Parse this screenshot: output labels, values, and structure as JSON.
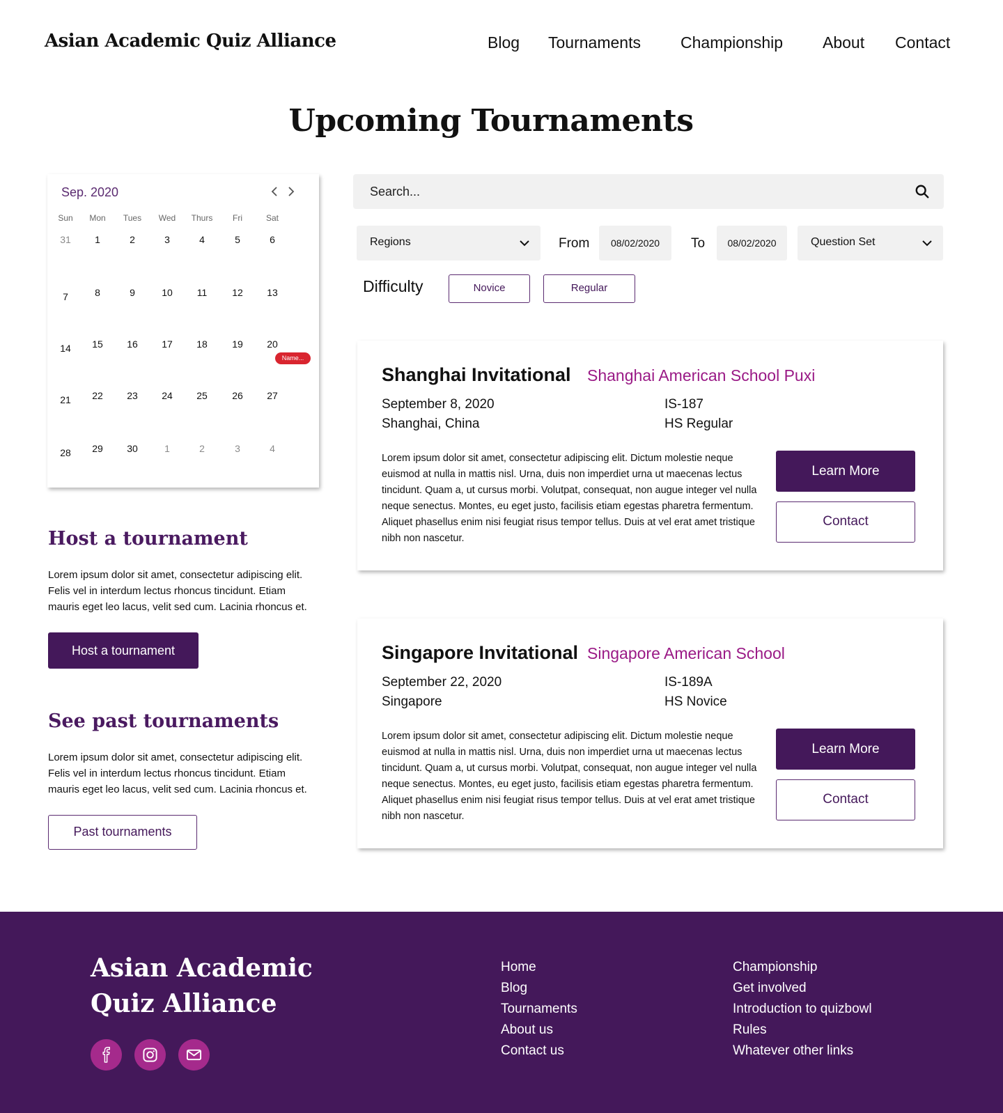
{
  "header": {
    "site_title": "Asian Academic Quiz Alliance",
    "nav": [
      "Blog",
      "Tournaments",
      "Championship",
      "About",
      "Contact"
    ]
  },
  "page_title": "Upcoming Tournaments",
  "calendar": {
    "month_label": "Sep. 2020",
    "prev_icon": "chevron-left-icon",
    "next_icon": "chevron-right-icon",
    "weekdays": [
      "Sun",
      "Mon",
      "Tues",
      "Wed",
      "Thurs",
      "Fri",
      "Sat"
    ],
    "weeks": [
      [
        "31",
        "1",
        "2",
        "3",
        "4",
        "5",
        "6"
      ],
      [
        "7",
        "8",
        "9",
        "10",
        "11",
        "12",
        "13"
      ],
      [
        "14",
        "15",
        "16",
        "17",
        "18",
        "19",
        "20"
      ],
      [
        "21",
        "22",
        "23",
        "24",
        "25",
        "26",
        "27"
      ],
      [
        "28",
        "29",
        "30",
        "1",
        "2",
        "3",
        "4"
      ]
    ],
    "event_badge": "Name...",
    "event_color": "#d9252f"
  },
  "sidebar": {
    "host": {
      "heading": "Host a tournament",
      "text": "Lorem ipsum dolor sit amet, consectetur adipiscing elit. Felis vel in interdum lectus rhoncus tincidunt. Etiam mauris eget leo lacus, velit sed cum. Lacinia rhoncus et.",
      "button": "Host a tournament"
    },
    "past": {
      "heading": "See past tournaments",
      "text": "Lorem ipsum dolor sit amet, consectetur adipiscing elit. Felis vel in interdum lectus rhoncus tincidunt. Etiam mauris eget leo lacus, velit sed cum. Lacinia rhoncus et.",
      "button": "Past tournaments"
    }
  },
  "search": {
    "placeholder": "Search...",
    "icon": "search-icon"
  },
  "filters": {
    "regions": "Regions",
    "from_label": "From",
    "from_date": "08/02/2020",
    "to_label": "To",
    "to_date": "08/02/2020",
    "question_set": "Question Set",
    "difficulty_label": "Difficulty",
    "difficulty_options": [
      "Novice",
      "Regular"
    ]
  },
  "tournaments": [
    {
      "name": "Shanghai Invitational",
      "school": "Shanghai American School Puxi",
      "date": "September 8, 2020",
      "location": "Shanghai, China",
      "code": "IS-187",
      "level": "HS Regular",
      "description": "Lorem ipsum dolor sit amet, consectetur adipiscing elit. Dictum molestie neque euismod at nulla in mattis nisl. Urna, duis non imperdiet urna ut maecenas lectus tincidunt. Quam a, ut cursus morbi. Volutpat, consequat, non augue integer vel nulla neque senectus. Montes, eu eget justo, facilisis etiam egestas pharetra fermentum. Aliquet phasellus enim nisi feugiat risus tempor tellus. Duis at vel erat amet tristique nibh non nascetur.",
      "learn_more": "Learn More",
      "contact": "Contact"
    },
    {
      "name": "Singapore Invitational",
      "school": "Singapore American School",
      "date": "September 22, 2020",
      "location": "Singapore",
      "code": "IS-189A",
      "level": "HS Novice",
      "description": "Lorem ipsum dolor sit amet, consectetur adipiscing elit. Dictum molestie neque euismod at nulla in mattis nisl. Urna, duis non imperdiet urna ut maecenas lectus tincidunt. Quam a, ut cursus morbi. Volutpat, consequat, non augue integer vel nulla neque senectus. Montes, eu eget justo, facilisis etiam egestas pharetra fermentum. Aliquet phasellus enim nisi feugiat risus tempor tellus. Duis at vel erat amet tristique nibh non nascetur.",
      "learn_more": "Learn More",
      "contact": "Contact"
    }
  ],
  "footer": {
    "title": "Asian Academic Quiz Alliance",
    "social_icons": [
      "facebook-icon",
      "instagram-icon",
      "mail-icon"
    ],
    "links_col1": [
      "Home",
      "Blog",
      "Tournaments",
      "About us",
      "Contact us"
    ],
    "links_col2": [
      "Championship",
      "Get involved",
      "Introduction to quizbowl",
      "Rules",
      "Whatever other links"
    ]
  },
  "colors": {
    "brand_purple": "#44185a",
    "accent_magenta": "#9a1a86",
    "social_bg": "#a52a8c"
  }
}
